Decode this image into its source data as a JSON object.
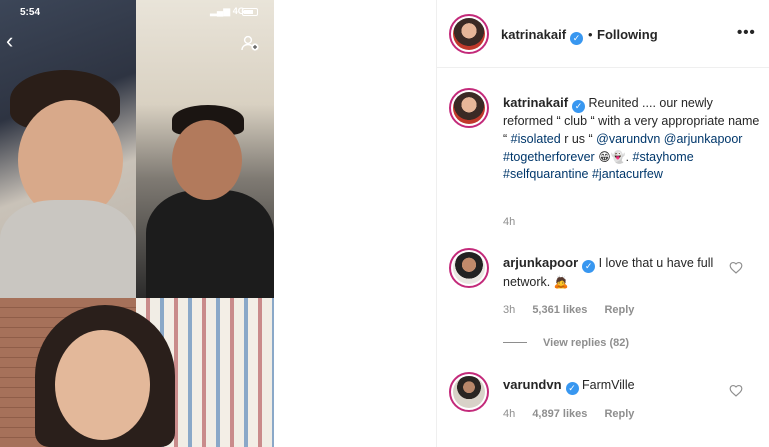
{
  "status_bar": {
    "time": "5:54",
    "network": "4G"
  },
  "post": {
    "username": "katrinakaif",
    "follow_separator": "•",
    "follow_state": "Following",
    "more_icon": "more-options-icon"
  },
  "caption": {
    "username": "katrinakaif",
    "text_1": "Reunited .... our newly reformed “ club “ with a very appropriate name “",
    "hashtag_isolated": "#isolated",
    "text_2": "r us “",
    "mention_1": "@varundvn",
    "mention_2": "@arjunkapoor",
    "hashtag_together": "#togetherforever",
    "emojis": "😁👻.",
    "hashtag_stayhome": "#stayhome",
    "hashtag_selfquarantine": "#selfquarantine",
    "hashtag_janta": "#jantacurfew",
    "time": "4h"
  },
  "comments": [
    {
      "username": "arjunkapoor",
      "text": "I love that u have full network.",
      "emoji": "🙇",
      "time": "3h",
      "likes": "5,361 likes",
      "reply": "Reply"
    },
    {
      "username": "varundvn",
      "text": "FarmVille",
      "time": "4h",
      "likes": "4,897 likes",
      "reply": "Reply"
    }
  ],
  "view_replies": "View replies (82)",
  "colors": {
    "link": "#00376b",
    "verified": "#3897f0",
    "muted": "#8e8e8e",
    "story_ring": "#c32a7a"
  }
}
